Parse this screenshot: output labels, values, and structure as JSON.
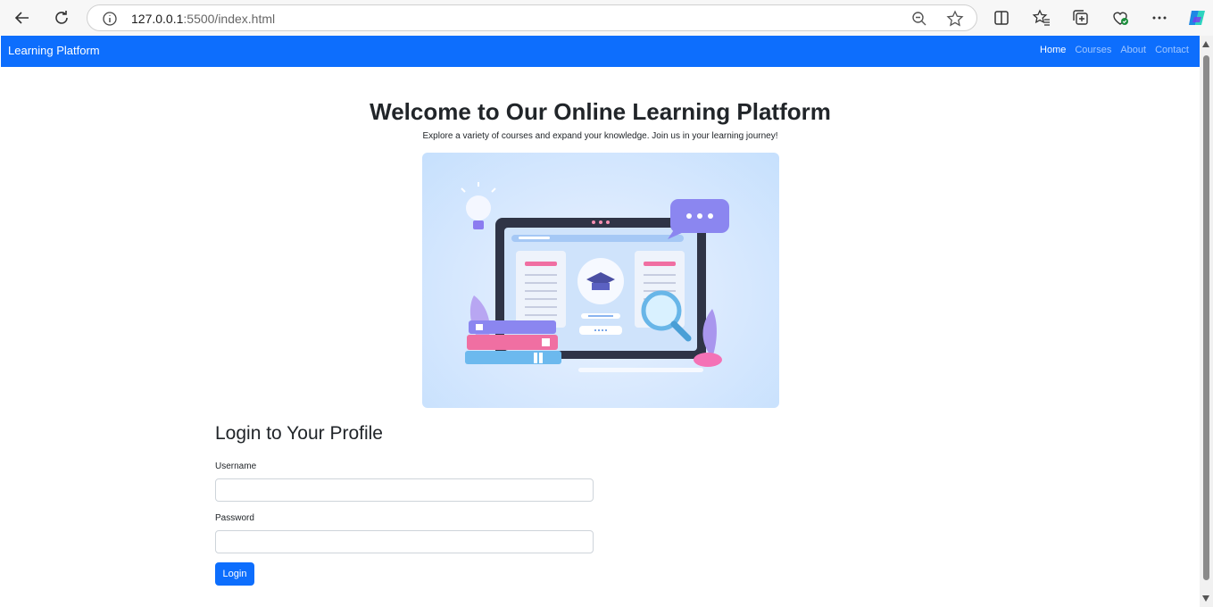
{
  "browser": {
    "url_host": "127.0.0.1",
    "url_rest": ":5500/index.html"
  },
  "navbar": {
    "brand": "Learning Platform",
    "links": [
      "Home",
      "Courses",
      "About",
      "Contact"
    ],
    "active": "Home"
  },
  "hero": {
    "title": "Welcome to Our Online Learning Platform",
    "subtitle": "Explore a variety of courses and expand your knowledge. Join us in your learning journey!",
    "image": "online-learning-laptop-illustration"
  },
  "login": {
    "heading": "Login to Your Profile",
    "username_label": "Username",
    "username_value": "",
    "password_label": "Password",
    "password_value": "",
    "button_label": "Login"
  },
  "colors": {
    "primary": "#0d6efd",
    "text": "#212529"
  }
}
